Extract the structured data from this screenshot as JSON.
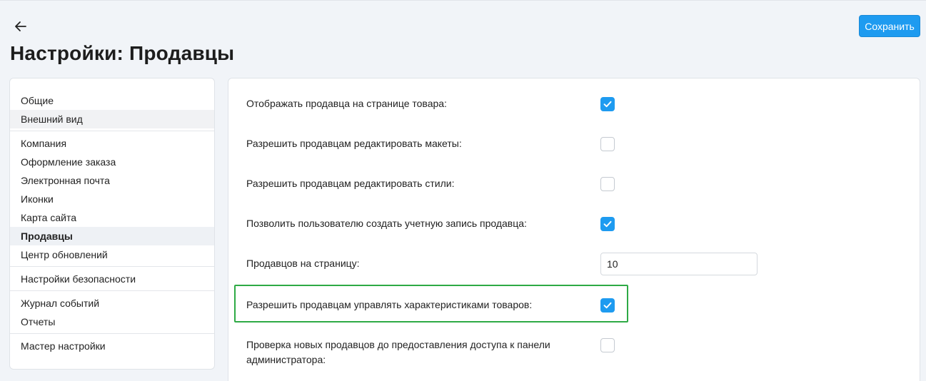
{
  "header": {
    "title": "Настройки: Продавцы",
    "save_label": "Сохранить",
    "back_icon": "arrow-left-icon"
  },
  "sidebar": {
    "items": [
      {
        "label": "Общие"
      },
      {
        "label": "Внешний вид"
      },
      {
        "label": "Компания"
      },
      {
        "label": "Оформление заказа"
      },
      {
        "label": "Электронная почта"
      },
      {
        "label": "Иконки"
      },
      {
        "label": "Карта сайта"
      },
      {
        "label": "Продавцы",
        "active": true
      },
      {
        "label": "Центр обновлений"
      },
      {
        "label": "Настройки безопасности"
      },
      {
        "label": "Журнал событий"
      },
      {
        "label": "Отчеты"
      },
      {
        "label": "Мастер настройки"
      }
    ]
  },
  "settings": [
    {
      "label": "Отображать продавца на странице товара:",
      "type": "checkbox",
      "checked": true
    },
    {
      "label": "Разрешить продавцам редактировать макеты:",
      "type": "checkbox",
      "checked": false
    },
    {
      "label": "Разрешить продавцам редактировать стили:",
      "type": "checkbox",
      "checked": false
    },
    {
      "label": "Позволить пользователю создать учетную запись продавца:",
      "type": "checkbox",
      "checked": true
    },
    {
      "label": "Продавцов на страницу:",
      "type": "input",
      "value": "10"
    },
    {
      "label": "Разрешить продавцам управлять характеристиками товаров:",
      "type": "checkbox",
      "checked": true
    },
    {
      "label": "Проверка новых продавцов до предоставления доступа к панели администратора:",
      "type": "checkbox",
      "checked": false
    }
  ],
  "colors": {
    "accent": "#1e9bf0",
    "highlight": "#2eaa45",
    "background": "#f1f4f8"
  }
}
